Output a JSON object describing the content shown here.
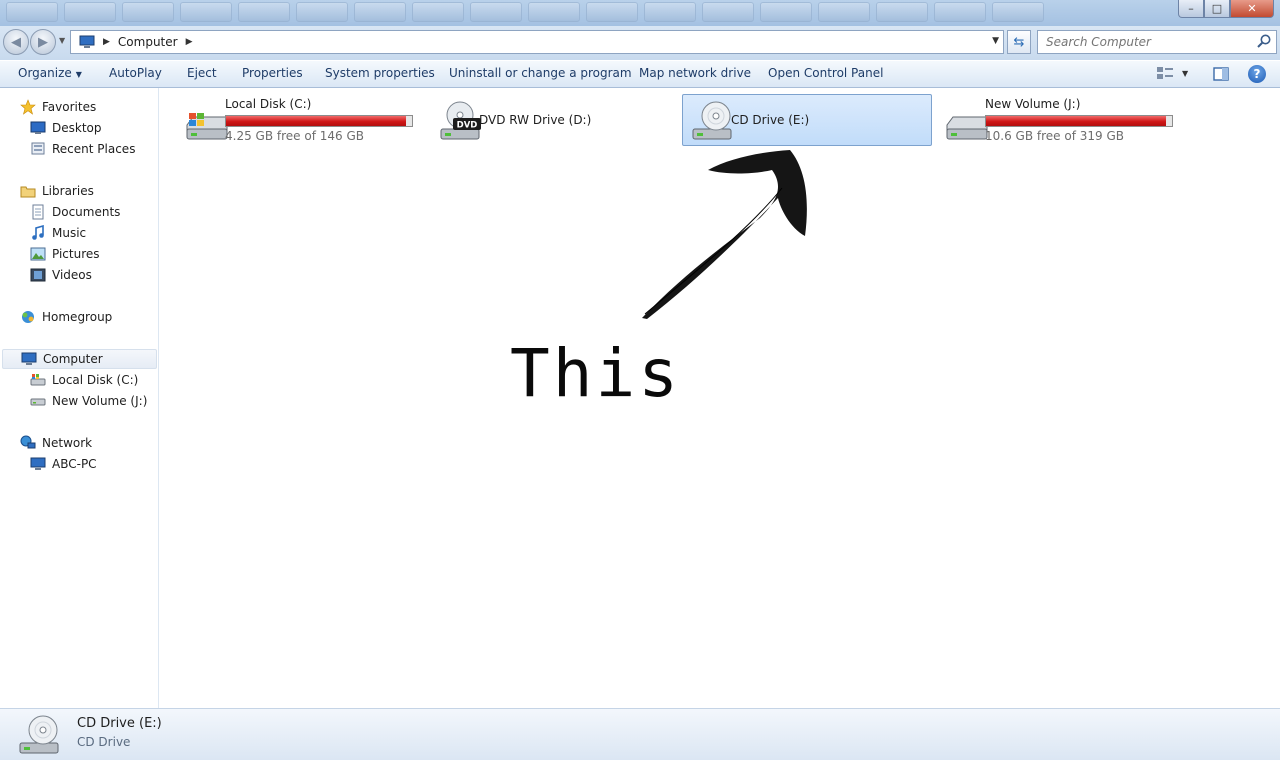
{
  "window": {
    "address": {
      "crumb": "Computer"
    },
    "search": {
      "placeholder": "Search Computer"
    }
  },
  "toolbar": {
    "organize": "Organize",
    "autoplay": "AutoPlay",
    "eject": "Eject",
    "properties": "Properties",
    "system_properties": "System properties",
    "uninstall": "Uninstall or change a program",
    "map_drive": "Map network drive",
    "control_panel": "Open Control Panel"
  },
  "nav": {
    "favorites": {
      "label": "Favorites",
      "items": [
        "Desktop",
        "Recent Places"
      ]
    },
    "libraries": {
      "label": "Libraries",
      "items": [
        "Documents",
        "Music",
        "Pictures",
        "Videos"
      ]
    },
    "homegroup": "Homegroup",
    "computer": {
      "label": "Computer",
      "items": [
        "Local Disk (C:)",
        "New Volume (J:)"
      ]
    },
    "network": {
      "label": "Network",
      "items": [
        "ABC-PC"
      ]
    }
  },
  "drives": [
    {
      "name": "Local Disk (C:)",
      "free_text": "4.25 GB free of 146 GB",
      "used_fraction": 0.97,
      "icon": "windows-hard-disk-icon"
    },
    {
      "name": "DVD RW Drive (D:)",
      "icon": "dvd-drive-icon"
    },
    {
      "name": "CD Drive (E:)",
      "icon": "cd-drive-icon",
      "selected": true
    },
    {
      "name": "New Volume (J:)",
      "free_text": "10.6 GB free of 319 GB",
      "used_fraction": 0.967,
      "icon": "hard-disk-icon"
    }
  ],
  "annotation": {
    "text": "This"
  },
  "details": {
    "name": "CD Drive (E:)",
    "type": "CD Drive"
  },
  "colors": {
    "capacity_bar": "#cf1616",
    "selection": "#c1dcfa",
    "link": "#1e3c68"
  }
}
